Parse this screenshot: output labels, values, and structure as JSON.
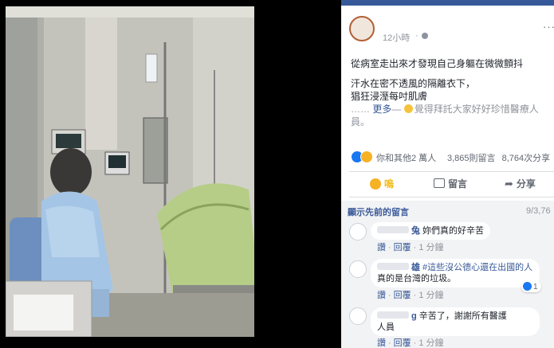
{
  "post": {
    "time": "12小時",
    "separator": "·",
    "menu_label": "···",
    "lines": [
      "從病室走出來才發現自己身軀在微微顫抖",
      "汗水在密不透風的隔離衣下，",
      "猖狂浸溼每吋肌膚"
    ],
    "more_prefix": "…… ",
    "more_label": "更多",
    "attached_prefix": "— ",
    "attached_text": "覺得拜託大家好好珍惜醫療人員。"
  },
  "reactions": {
    "names": "你和其他2 萬人",
    "comments_count": "3,865則留言",
    "shares_count": "8,764次分享"
  },
  "actions": {
    "sad_label": "嗚",
    "comment_label": "留言",
    "share_label": "分享"
  },
  "comments": {
    "previous_label": "顯示先前的留言",
    "previous_count": "9/3,76",
    "reply_label": "回覆",
    "like_label": "讚",
    "items": [
      {
        "name": "兔",
        "text": "妳們真的好辛苦",
        "age": "1 分鐘"
      },
      {
        "name": "雄",
        "tag": "#這些沒公德心還在出國的人",
        "text": "真的是台灣的垃圾。",
        "age": "1 分鐘",
        "likes": "1"
      },
      {
        "name": "g",
        "text": "辛苦了，謝謝所有醫護",
        "text2": "人員",
        "age": "1 分鐘"
      }
    ]
  },
  "colors": {
    "link": "#385898",
    "meta": "#90949c",
    "sad": "#f7b125",
    "like": "#1877f2"
  }
}
